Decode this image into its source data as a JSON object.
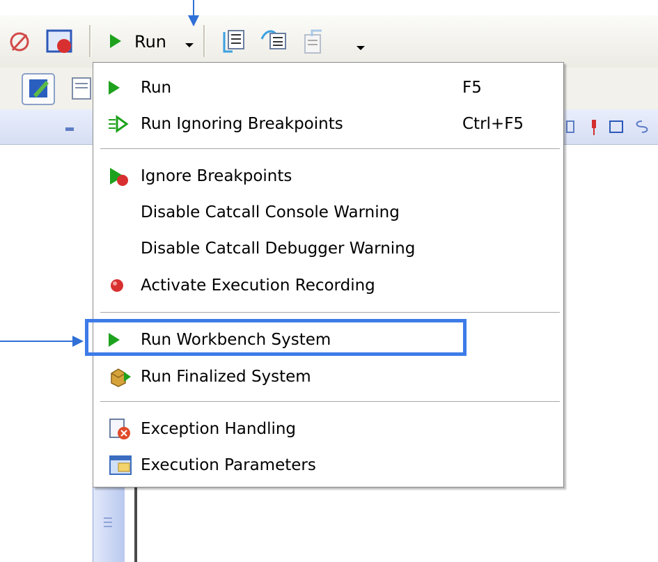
{
  "toolbar": {
    "run_label": "Run"
  },
  "menu": {
    "items": [
      {
        "label": "Run",
        "accel": "F5",
        "icon": "run-arrow-icon"
      },
      {
        "label": "Run Ignoring Breakpoints",
        "accel": "Ctrl+F5",
        "icon": "run-ignoring-breakpoints-icon"
      },
      {
        "label": "Ignore Breakpoints",
        "accel": "",
        "icon": "ignore-breakpoints-icon"
      },
      {
        "label": "Disable Catcall Console Warning",
        "accel": "",
        "icon": ""
      },
      {
        "label": "Disable Catcall Debugger Warning",
        "accel": "",
        "icon": ""
      },
      {
        "label": "Activate Execution Recording",
        "accel": "",
        "icon": "record-dot-icon"
      },
      {
        "label": "Run Workbench System",
        "accel": "",
        "icon": "run-arrow-icon"
      },
      {
        "label": "Run Finalized System",
        "accel": "",
        "icon": "finalized-package-icon"
      },
      {
        "label": "Exception Handling",
        "accel": "",
        "icon": "exception-handling-icon"
      },
      {
        "label": "Execution Parameters",
        "accel": "",
        "icon": "execution-parameters-icon"
      }
    ]
  },
  "colors": {
    "run_green": "#1ea21e",
    "annotation_blue": "#3d7be8",
    "record_red": "#d83030"
  }
}
